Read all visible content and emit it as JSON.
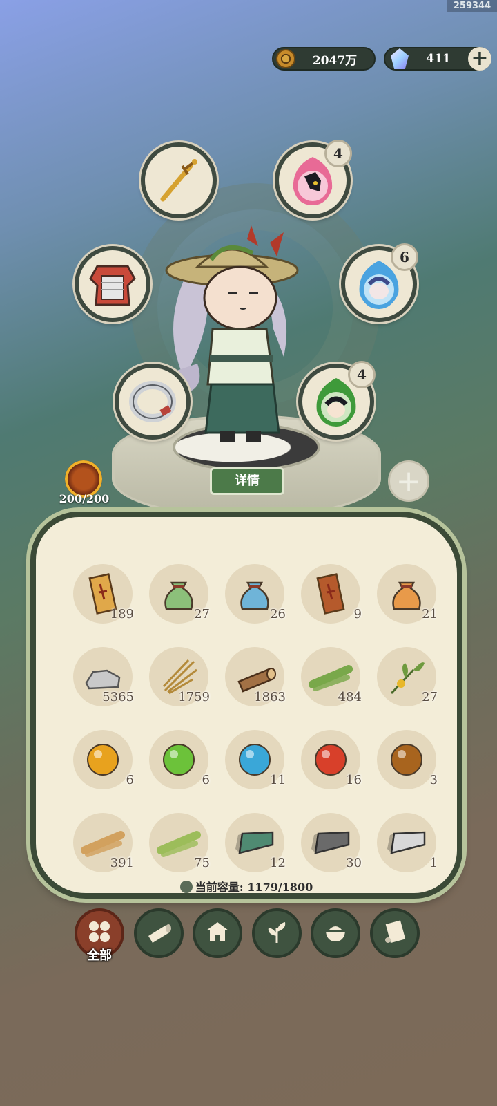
{
  "corner_id": "259344",
  "currency": {
    "coins": "2047万",
    "gems": "411",
    "add_symbol": "+"
  },
  "equipment_slots": [
    {
      "name": "weapon-slot",
      "item": "sword-icon"
    },
    {
      "name": "pet-slot-1",
      "item": "jackal-spirit-icon",
      "badge": "4"
    },
    {
      "name": "armor-slot",
      "item": "armor-icon"
    },
    {
      "name": "pet-slot-2",
      "item": "blue-spirit-icon",
      "badge": "6"
    },
    {
      "name": "ring-slot",
      "item": "ring-icon"
    },
    {
      "name": "pet-slot-3",
      "item": "green-spirit-icon",
      "badge": "4"
    }
  ],
  "stage": {
    "detail_label": "详情",
    "add_symbol": "+"
  },
  "stamina": {
    "value": "200/200"
  },
  "inventory": {
    "rows": [
      [
        {
          "icon": "scroll-talisman-icon",
          "qty": "189",
          "color": "#e0a84a"
        },
        {
          "icon": "green-pouch-icon",
          "qty": "27",
          "color": "#8cc07a"
        },
        {
          "icon": "blue-pouch-icon",
          "qty": "26",
          "color": "#6fb4d8"
        },
        {
          "icon": "tag-talisman-icon",
          "qty": "9",
          "color": "#b55a2c"
        },
        {
          "icon": "orange-pouch-icon",
          "qty": "21",
          "color": "#e89a4a"
        }
      ],
      [
        {
          "icon": "stone-icon",
          "qty": "5365",
          "color": "#c9c9c9"
        },
        {
          "icon": "straw-icon",
          "qty": "1759",
          "color": "#b48a3a"
        },
        {
          "icon": "log-icon",
          "qty": "1863",
          "color": "#a27145"
        },
        {
          "icon": "bamboo-icon",
          "qty": "484",
          "color": "#79a84a"
        },
        {
          "icon": "herb-icon",
          "qty": "27",
          "color": "#6e9a3e"
        }
      ],
      [
        {
          "icon": "gold-orb-icon",
          "qty": "6",
          "color": "#e8a21e"
        },
        {
          "icon": "green-orb-icon",
          "qty": "6",
          "color": "#6cc23a"
        },
        {
          "icon": "water-orb-icon",
          "qty": "11",
          "color": "#3aa7d8"
        },
        {
          "icon": "fire-orb-icon",
          "qty": "16",
          "color": "#d8402a"
        },
        {
          "icon": "earth-orb-icon",
          "qty": "3",
          "color": "#a8641e"
        }
      ],
      [
        {
          "icon": "planks-icon",
          "qty": "391",
          "color": "#d2a15e"
        },
        {
          "icon": "bamboo-strips-icon",
          "qty": "75",
          "color": "#9cbd5a"
        },
        {
          "icon": "jade-ingot-icon",
          "qty": "12",
          "color": "#4f8a72"
        },
        {
          "icon": "iron-ingot-icon",
          "qty": "30",
          "color": "#6a6a6a"
        },
        {
          "icon": "silver-ingot-icon",
          "qty": "1",
          "color": "#d8d8d8"
        }
      ]
    ],
    "capacity_label": "当前容量:",
    "capacity_value": "1179/1800"
  },
  "tabs": [
    {
      "name": "tab-all",
      "icon": "grid-dots-icon",
      "label": "全部",
      "active": true
    },
    {
      "name": "tab-wood",
      "icon": "log-icon",
      "label": ""
    },
    {
      "name": "tab-building",
      "icon": "house-icon",
      "label": ""
    },
    {
      "name": "tab-herb",
      "icon": "leaf-icon",
      "label": ""
    },
    {
      "name": "tab-food",
      "icon": "bowl-icon",
      "label": ""
    },
    {
      "name": "tab-scroll",
      "icon": "scroll-icon",
      "label": ""
    }
  ]
}
